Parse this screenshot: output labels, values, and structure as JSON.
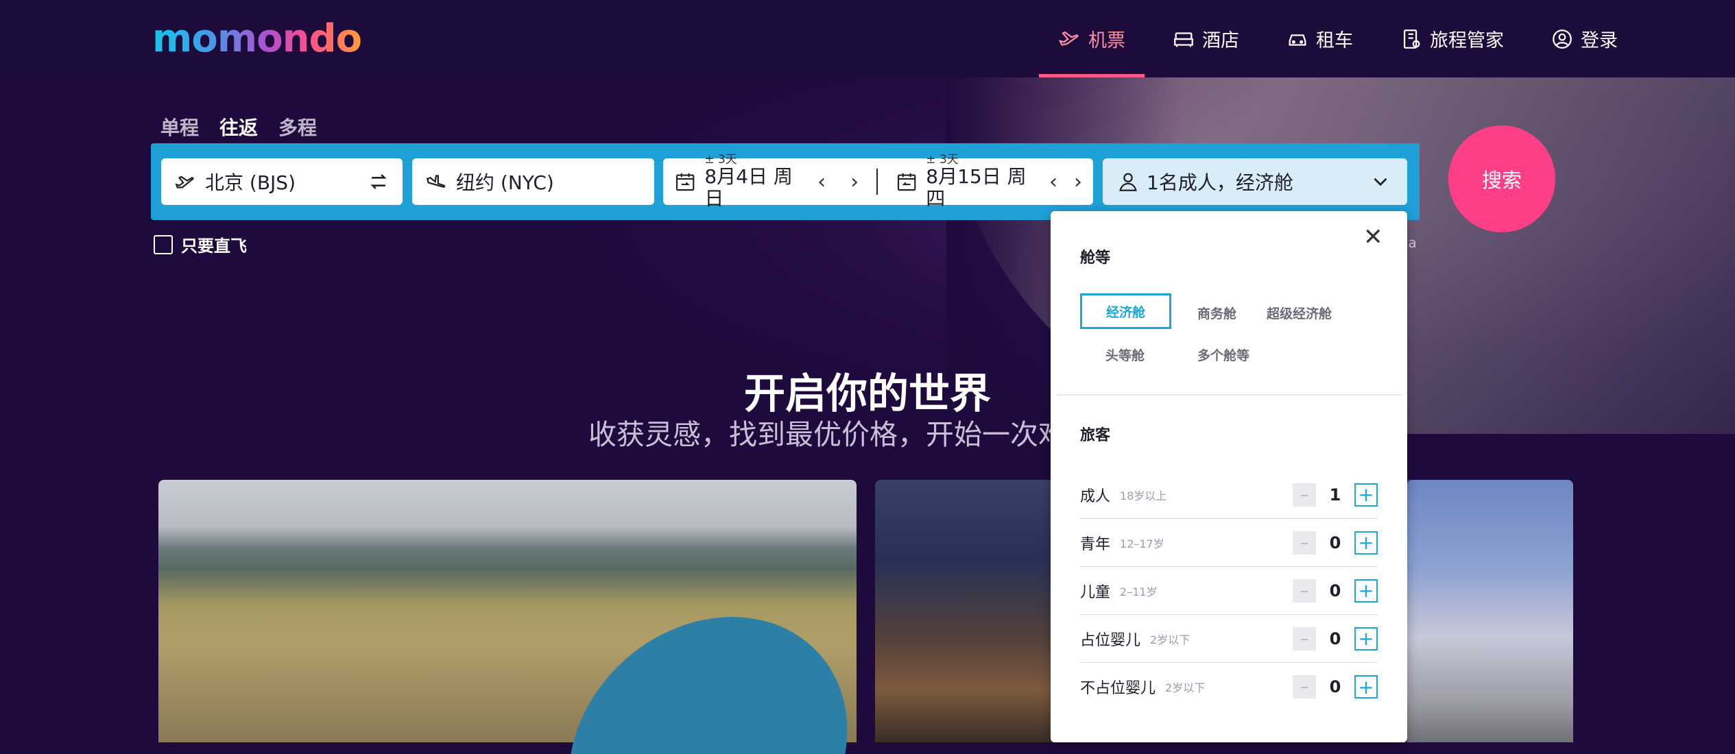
{
  "header": {
    "logo": "momondo",
    "nav": [
      {
        "label": "机票",
        "icon": "plane-icon",
        "active": true
      },
      {
        "label": "酒店",
        "icon": "bed-icon",
        "active": false
      },
      {
        "label": "租车",
        "icon": "car-icon",
        "active": false
      },
      {
        "label": "旅程管家",
        "icon": "trips-icon",
        "active": false
      },
      {
        "label": "登录",
        "icon": "user-icon",
        "active": false
      }
    ]
  },
  "trip_types": [
    "单程",
    "往返",
    "多程"
  ],
  "trip_type_selected": "往返",
  "search": {
    "origin": "北京 (BJS)",
    "destination": "纽约 (NYC)",
    "depart_flex": "± 3天",
    "depart_date": "8月4日 周日",
    "return_flex": "± 3天",
    "return_date": "8月15日 周四",
    "passengers": "1名成人，经济舱",
    "search_button": "搜索"
  },
  "direct_only": "只要直飞",
  "hero": {
    "title": "开启你的世界",
    "subtitle": "收获灵感，找到最优价格，开始一次难",
    "partial_text": "ia"
  },
  "panel": {
    "cabin_title": "舱等",
    "cabins": [
      "经济舱",
      "商务舱",
      "超级经济舱",
      "头等舱",
      "多个舱等"
    ],
    "cabin_selected": "经济舱",
    "travelers_title": "旅客",
    "travelers": [
      {
        "label": "成人",
        "sub": "18岁以上",
        "count": "1"
      },
      {
        "label": "青年",
        "sub": "12–17岁",
        "count": "0"
      },
      {
        "label": "儿童",
        "sub": "2–11岁",
        "count": "0"
      },
      {
        "label": "占位婴儿",
        "sub": "2岁以下",
        "count": "0"
      },
      {
        "label": "不占位婴儿",
        "sub": "2岁以下",
        "count": "0"
      }
    ],
    "minus": "–",
    "plus": "+"
  },
  "colors": {
    "header_bg": "#1d0b3c",
    "page_bg": "#1f0a3e",
    "search_bar": "#1fa0d6",
    "search_button": "#ff3e88",
    "accent_blue": "#18a8dc",
    "active_nav": "#ff8fa7"
  }
}
